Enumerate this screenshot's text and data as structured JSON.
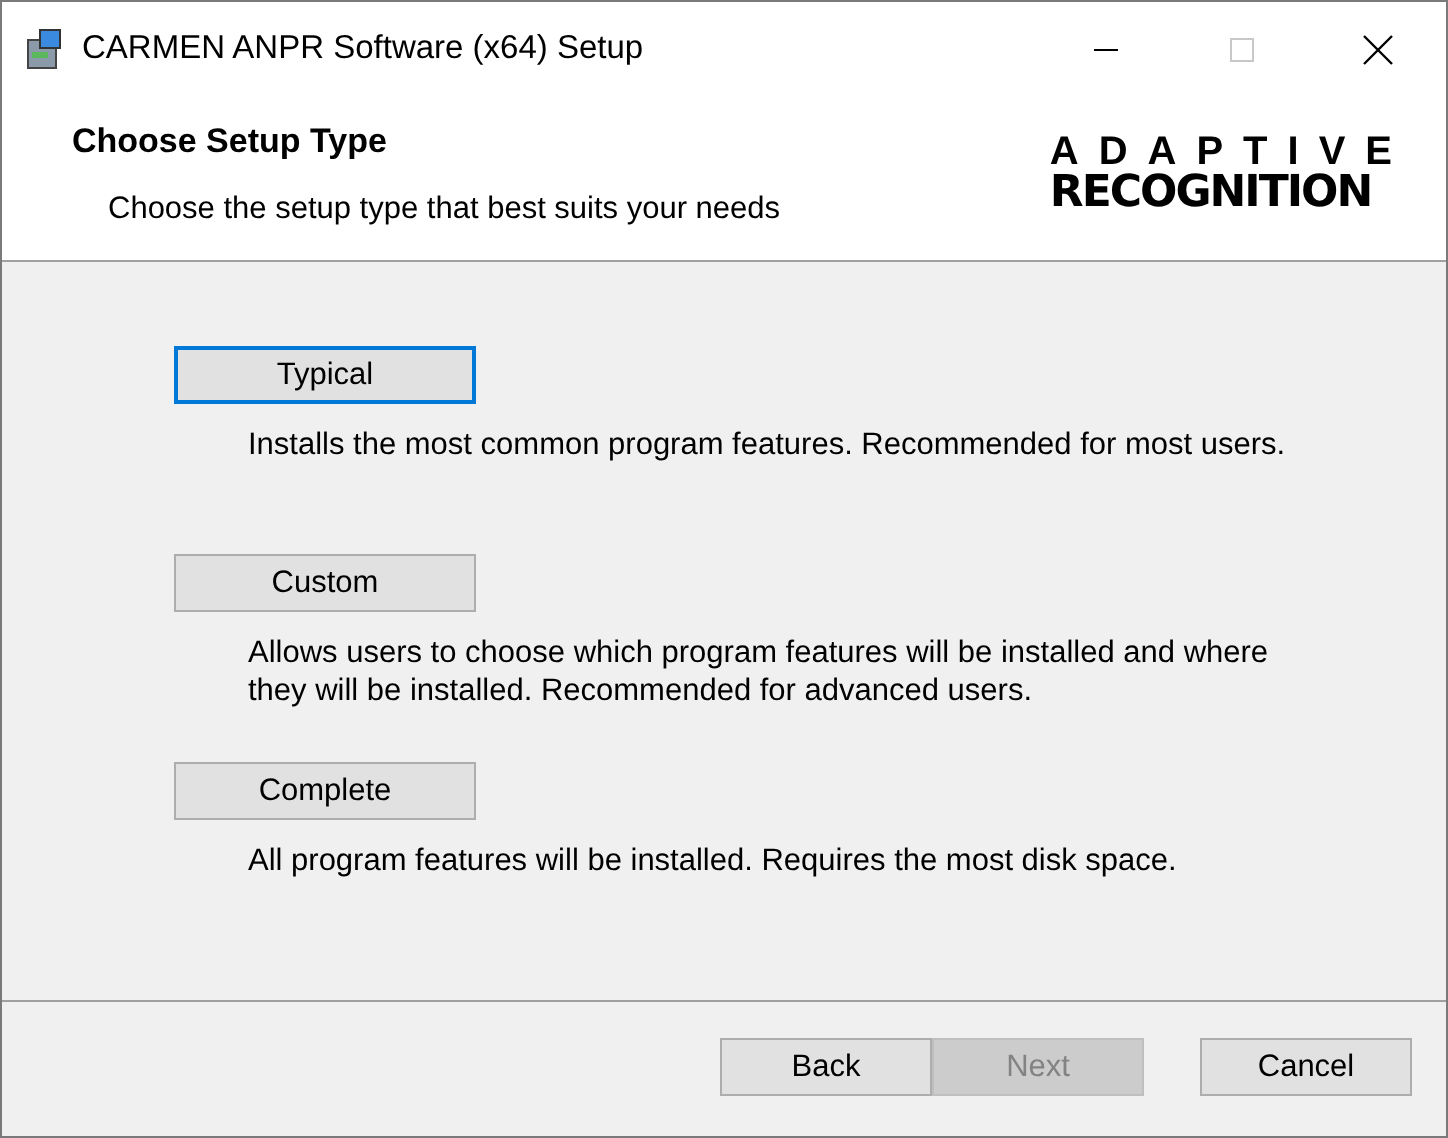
{
  "window": {
    "title": "CARMEN ANPR Software (x64) Setup"
  },
  "header": {
    "title": "Choose Setup Type",
    "subtitle": "Choose the setup type that best suits your needs",
    "logo": [
      "ADAPTIVE",
      "RECOGNITION"
    ]
  },
  "options": [
    {
      "label": "Typical",
      "focused": true,
      "description": "Installs the most common program features. Recommended for most users."
    },
    {
      "label": "Custom",
      "focused": false,
      "description": "Allows users to choose which program features will be installed and where they will be installed. Recommended for advanced users."
    },
    {
      "label": "Complete",
      "focused": false,
      "description": "All program features will be installed. Requires the most disk space."
    }
  ],
  "buttons": [
    {
      "label": "Back",
      "disabled": false
    },
    {
      "label": "Next",
      "disabled": true
    },
    {
      "label": "Cancel",
      "disabled": false
    }
  ]
}
